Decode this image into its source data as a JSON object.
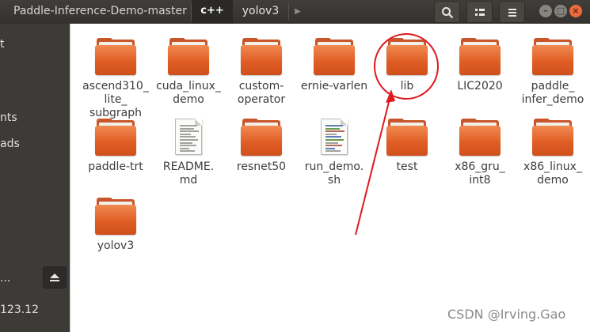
{
  "header": {
    "breadcrumb": [
      "Paddle-Inference-Demo-master",
      "c++",
      "yolov3"
    ],
    "icons": {
      "next": "chevron-right-icon",
      "search": "search-icon",
      "view": "view-options-icon",
      "menu": "hamburger-menu-icon",
      "minimize": "minimize-icon",
      "maximize": "maximize-icon",
      "close": "close-icon"
    },
    "window_buttons": {
      "minimize": "–",
      "maximize": "□",
      "close": "×"
    }
  },
  "sidebar": {
    "texts": [
      "t",
      "nts",
      "ads",
      "...",
      "123.12"
    ],
    "eject_icon": "eject-icon"
  },
  "files": [
    {
      "name": "ascend310_\nlite_\nsubgraph",
      "type": "folder"
    },
    {
      "name": "cuda_linux_\ndemo",
      "type": "folder"
    },
    {
      "name": "custom-\noperator",
      "type": "folder"
    },
    {
      "name": "ernie-varlen",
      "type": "folder"
    },
    {
      "name": "lib",
      "type": "folder"
    },
    {
      "name": "LIC2020",
      "type": "folder"
    },
    {
      "name": "paddle_\ninfer_demo",
      "type": "folder"
    },
    {
      "name": "paddle-trt",
      "type": "folder"
    },
    {
      "name": "README.\nmd",
      "type": "text-document"
    },
    {
      "name": "resnet50",
      "type": "folder"
    },
    {
      "name": "run_demo.\nsh",
      "type": "script-document"
    },
    {
      "name": "test",
      "type": "folder"
    },
    {
      "name": "x86_gru_\nint8",
      "type": "folder"
    },
    {
      "name": "x86_linux_\ndemo",
      "type": "folder"
    },
    {
      "name": "yolov3",
      "type": "folder"
    }
  ],
  "annotation": {
    "color": "#e0191e",
    "target": "lib"
  },
  "watermark": "CSDN @Irving.Gao",
  "colors": {
    "header": "#3c3b37",
    "folder_orange": "#e5642a",
    "close_button": "#ec6a3d"
  }
}
